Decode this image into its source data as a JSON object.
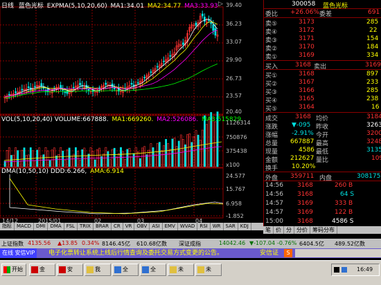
{
  "chart_header": {
    "period": "日线",
    "stock_name": "蓝色光标",
    "expma": "EXPMA(5,10,20,60)",
    "ma1": "MA1:34.01",
    "ma2": "MA2:34.77",
    "ma3": "MA3:33.93",
    "arrow": "▷"
  },
  "price_axis": [
    "39.40",
    "36.23",
    "33.07",
    "29.90",
    "26.73",
    "23.57",
    "20.40"
  ],
  "vol_header": {
    "vol": "VOL(5,10,20,40) VOLUME:667888.",
    "ma1": "MA1:669260.",
    "ma2": "MA2:526086.",
    "ma3": "MA3:515829."
  },
  "vol_axis": [
    "1126314",
    "750876",
    "375438",
    "x100"
  ],
  "dma_header": {
    "dma": "DMA(10,50,10) DDD:6.266,",
    "ama": "AMA:6.914"
  },
  "dma_axis": [
    "24.577",
    "15.767",
    "6.958",
    "-1.852"
  ],
  "date_axis": [
    "14/12",
    "2015/01",
    "02",
    "03",
    "04"
  ],
  "indicator_tabs": [
    "指标",
    "MACD",
    "DMI",
    "DMA",
    "FSL",
    "TRIX",
    "BRAR",
    "CR",
    "VR",
    "OBV",
    "ASI",
    "EMV",
    "WVAD",
    "RSI",
    "WR",
    "SAR",
    "KDJ"
  ],
  "quote": {
    "code": "300058",
    "name": "蓝色光标",
    "weibi_label": "委比",
    "weibi": "+26.06%",
    "weicha_label": "委差",
    "weicha": "691",
    "sells": [
      {
        "label": "卖⑤",
        "price": "3173",
        "vol": "285"
      },
      {
        "label": "卖④",
        "price": "3172",
        "vol": "22"
      },
      {
        "label": "卖③",
        "price": "3171",
        "vol": "154"
      },
      {
        "label": "卖②",
        "price": "3170",
        "vol": "184"
      },
      {
        "label": "卖①",
        "price": "3169",
        "vol": "334"
      }
    ],
    "mairu_label": "买入",
    "mairu": "3168",
    "maichu_label": "卖出",
    "maichu": "3169",
    "buys": [
      {
        "label": "买①",
        "price": "3168",
        "vol": "897"
      },
      {
        "label": "买②",
        "price": "3167",
        "vol": "233"
      },
      {
        "label": "买③",
        "price": "3166",
        "vol": "285"
      },
      {
        "label": "买④",
        "price": "3165",
        "vol": "238"
      },
      {
        "label": "买⑤",
        "price": "3164",
        "vol": "16"
      }
    ],
    "stats": [
      {
        "l1": "成交",
        "v1": "3168",
        "l2": "均价",
        "v2": "3184"
      },
      {
        "l1": "涨跌",
        "v1": "▼-095",
        "l2": "昨收",
        "v2": "3263"
      },
      {
        "l1": "涨幅",
        "v1": "-2.91%",
        "l2": "今开",
        "v2": "3200"
      },
      {
        "l1": "总量",
        "v1": "667887",
        "l2": "最高",
        "v2": "3248"
      },
      {
        "l1": "现量",
        "v1": "4586",
        "l2": "最低",
        "v2": "3135"
      },
      {
        "l1": "金额",
        "v1": "212627",
        "l2": "量比",
        "v2": "109"
      },
      {
        "l1": "换手",
        "v1": "10.20%",
        "l2": "",
        "v2": ""
      }
    ],
    "waipan_label": "外盘",
    "waipan": "359711",
    "neipan_label": "内盘",
    "neipan": "308175",
    "ticks": [
      {
        "t": "14:56",
        "p": "3168",
        "v": "260 B"
      },
      {
        "t": "14:56",
        "p": "3168",
        "v": "64 S"
      },
      {
        "t": "14:57",
        "p": "3169",
        "v": "333 B"
      },
      {
        "t": "14:57",
        "p": "3169",
        "v": "122 B"
      },
      {
        "t": "15:00",
        "p": "3168",
        "v": "4586 S"
      }
    ]
  },
  "quote_tabs": [
    "笔",
    "价",
    "分",
    "分价",
    "筹码分布"
  ],
  "status": {
    "index_label": "上证指数",
    "index_val": "4135.56",
    "index_chg": "▲13.85",
    "index_pct": "0.34%",
    "index_amt": "8146.45亿",
    "index_amt2": "610.68亿数",
    "sz_label": "深证成指",
    "sz_val": "14042.46",
    "sz_chg": "▼-107.04",
    "sz_pct": "-0.76%",
    "sz_amt": "6404.5亿",
    "sz_amt2": "489.52亿数"
  },
  "ticker": {
    "badge": "在线 安信VIP",
    "msg": "电子化票转让系统上线后行情查询及委托交易方式变更的公告。",
    "right": "安信证"
  },
  "taskbar": {
    "start": "开始",
    "items": [
      "金",
      "安",
      "我",
      "全",
      "全",
      "未",
      "未"
    ],
    "clock": "16:49"
  },
  "colors": {
    "up": "#ff3232",
    "down": "#00e0e0",
    "ma_white": "#ffffff",
    "ma_yellow": "#ffff00",
    "ma_magenta": "#ff00ff",
    "ma_green": "#00ff00",
    "grid": "#8b0000"
  }
}
